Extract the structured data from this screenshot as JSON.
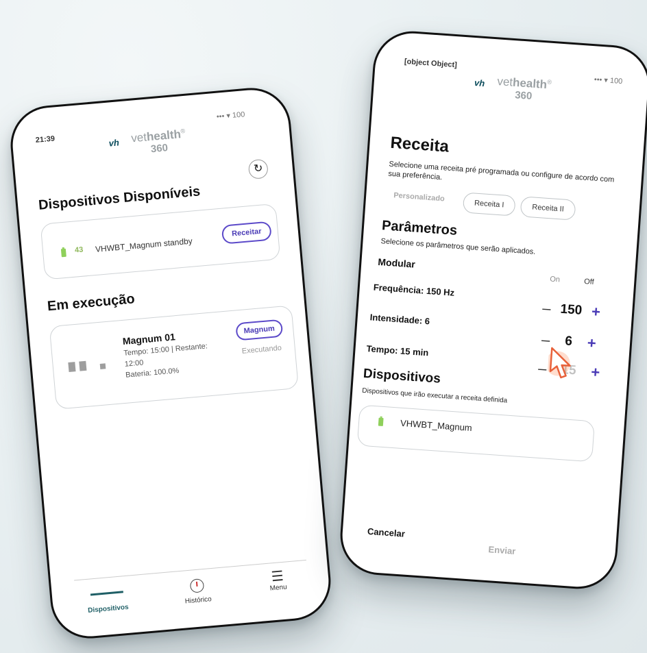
{
  "left_screen": {
    "time": "21:39",
    "status": "••• ▾ 100",
    "logo": {
      "short": "vh",
      "brand_light": "vet",
      "brand_bold": "health",
      "reg": "®",
      "suffix": "360"
    },
    "available_title": "Dispositivos Disponíveis",
    "device": {
      "battery": "43",
      "name": "VHWBT_Magnum standby",
      "button": "Receitar"
    },
    "running_title": "Em execução",
    "running": {
      "name": "Magnum 01",
      "time_line": "Tempo: 15:00 | Restante:",
      "remaining": "12:00",
      "battery_line": "Bateria: 100.0%",
      "button": "Magnum",
      "status": "Executando"
    },
    "nav": [
      {
        "label": "Dispositivos",
        "icon": "devices-indicator"
      },
      {
        "label": "Histórico",
        "icon": "clock-icon"
      },
      {
        "label": "Menu",
        "icon": "menu-icon"
      }
    ]
  },
  "right_screen": {
    "time": {
      "label": "Tempo: 15 min",
      "value": "15"
    },
    "status": "••• ▾ 100",
    "logo": {
      "short": "vh",
      "brand_light": "vet",
      "brand_bold": "health",
      "reg": "®",
      "suffix": "360"
    },
    "title": "Receita",
    "subtitle": "Selecione uma receita pré programada ou configure de acordo com sua preferência.",
    "tabs": [
      "Personalizado",
      "Receita I",
      "Receita II"
    ],
    "params_title": "Parâmetros",
    "params_subtitle": "Selecione os parâmetros que serão aplicados.",
    "modular_label": "Modular",
    "on_label": "On",
    "off_label": "Off",
    "frequency": {
      "label": "Frequência: 150 Hz",
      "value": "150"
    },
    "intensity": {
      "label": "Intensidade: 6",
      "value": "6"
    },
    "minus": "–",
    "plus": "+",
    "devices_title": "Dispositivos",
    "devices_subtitle": "Dispositivos que irão executar a receita definida",
    "device_name": "VHWBT_Magnum",
    "cancel": "Cancelar",
    "send": "Enviar"
  },
  "colors": {
    "accent": "#4a3bb6",
    "brand_teal": "#0b4c5c",
    "battery_green": "#8fd05b"
  }
}
